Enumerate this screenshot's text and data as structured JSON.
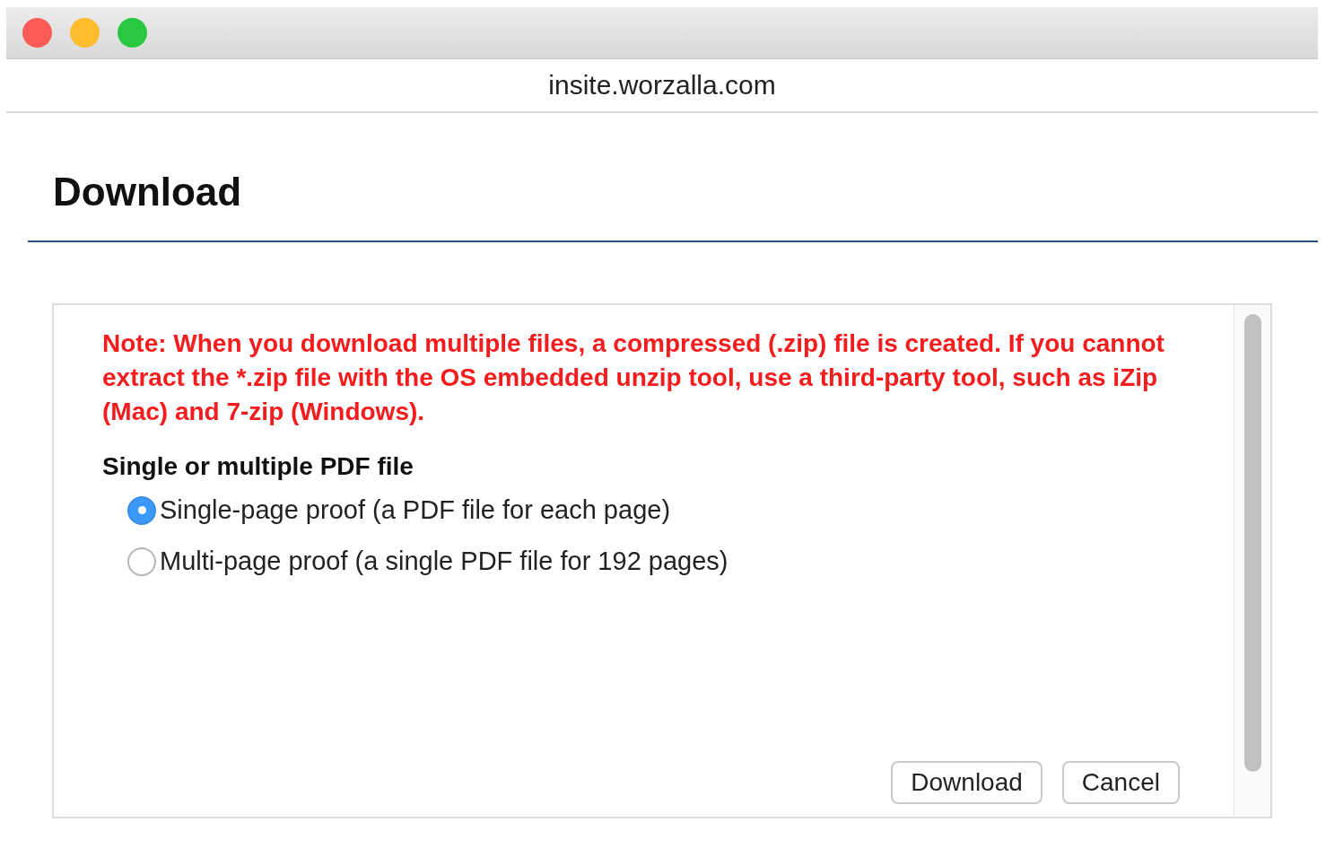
{
  "window": {
    "url": "insite.worzalla.com"
  },
  "dialog": {
    "title": "Download",
    "note": "Note: When you download multiple files, a compressed (.zip) file is created. If you cannot extract the *.zip file with the OS embedded unzip tool, use a third-party tool, such as iZip (Mac) and 7-zip (Windows).",
    "section_label": "Single or multiple PDF file",
    "options": [
      {
        "label": "Single-page proof (a PDF file for each page)",
        "selected": true
      },
      {
        "label": "Multi-page proof (a single PDF file for 192 pages)",
        "selected": false
      }
    ],
    "buttons": [
      "Download",
      "Cancel"
    ]
  }
}
